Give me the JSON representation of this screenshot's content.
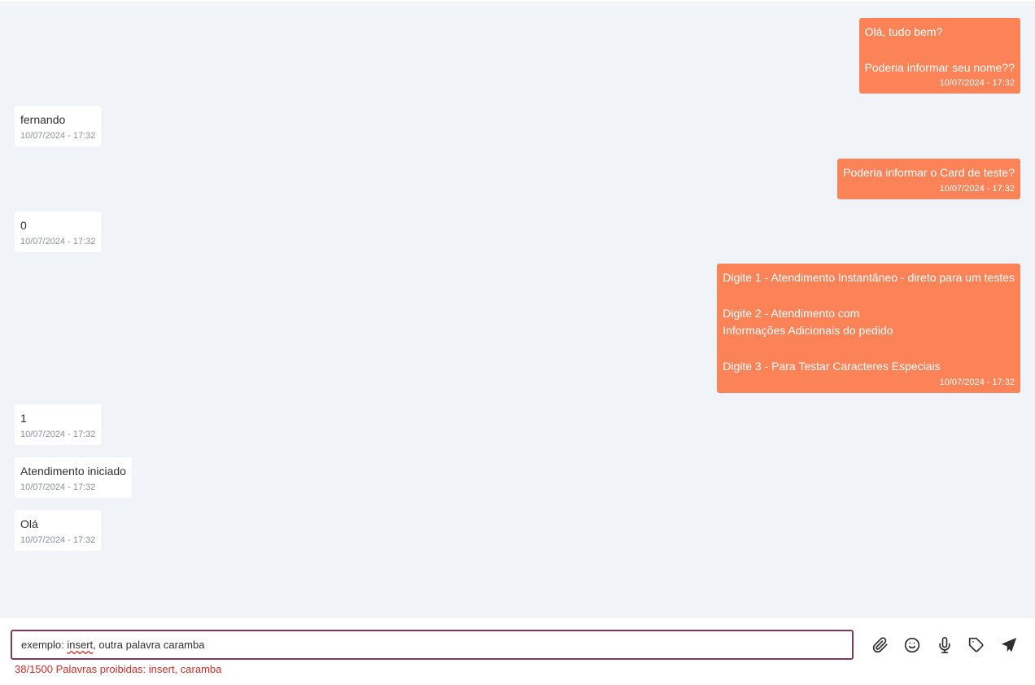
{
  "messages": [
    {
      "direction": "out",
      "text": "Olá, tudo bem?\n\nPoderia informar seu nome??",
      "time": "10/07/2024 - 17:32"
    },
    {
      "direction": "in",
      "text": "fernando",
      "time": "10/07/2024 - 17:32"
    },
    {
      "direction": "out",
      "text": "Poderia informar o Card de teste?",
      "time": "10/07/2024 - 17:32"
    },
    {
      "direction": "in",
      "text": "0",
      "time": "10/07/2024 - 17:32"
    },
    {
      "direction": "out",
      "text": "Digite 1 - Atendimento Instantâneo - direto para um testes\n\nDigite 2 - Atendimento com\nInformações Adicionais do pedido\n\nDigite 3 - Para Testar Caracteres Especiais",
      "time": "10/07/2024 - 17:32"
    },
    {
      "direction": "in",
      "text": "1",
      "time": "10/07/2024 - 17:32"
    },
    {
      "direction": "in",
      "text": "Atendimento iniciado",
      "time": "10/07/2024 - 17:32"
    },
    {
      "direction": "in",
      "text": "Olá",
      "time": "10/07/2024 - 17:32"
    }
  ],
  "composer": {
    "input_value_prefix": "exemplo: ",
    "input_value_flagged": "insert",
    "input_value_suffix": ", outra palavra caramba",
    "counter_text": "38/1500 Palavras proibidas: insert, caramba"
  },
  "toolbar": {
    "icons": [
      "paperclip-icon",
      "emoji-icon",
      "microphone-icon",
      "tag-icon",
      "send-icon"
    ]
  },
  "colors": {
    "outgoing_bubble": "#fc8358",
    "incoming_bubble": "#ffffff",
    "chat_background": "#f0f4f9",
    "input_border": "#7b3a5e",
    "warning_text": "#c9302c"
  }
}
